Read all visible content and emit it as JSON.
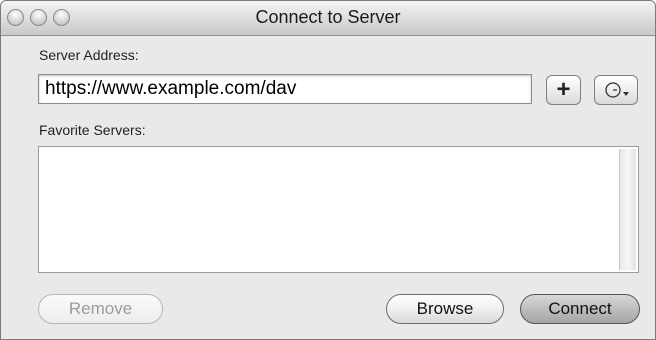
{
  "window": {
    "title": "Connect to Server"
  },
  "server_address": {
    "label": "Server Address:",
    "value": "https://www.example.com/dav"
  },
  "favorites": {
    "label": "Favorite Servers:",
    "items": []
  },
  "buttons": {
    "add_label": "+",
    "remove_label": "Remove",
    "browse_label": "Browse",
    "connect_label": "Connect"
  },
  "icons": {
    "recent_servers": "clock-dropdown-icon",
    "add": "plus-icon"
  },
  "colors": {
    "titlebar": "#d9d9d9",
    "window_bg": "#e9e9e9",
    "default_button": "#bdbdbd"
  }
}
